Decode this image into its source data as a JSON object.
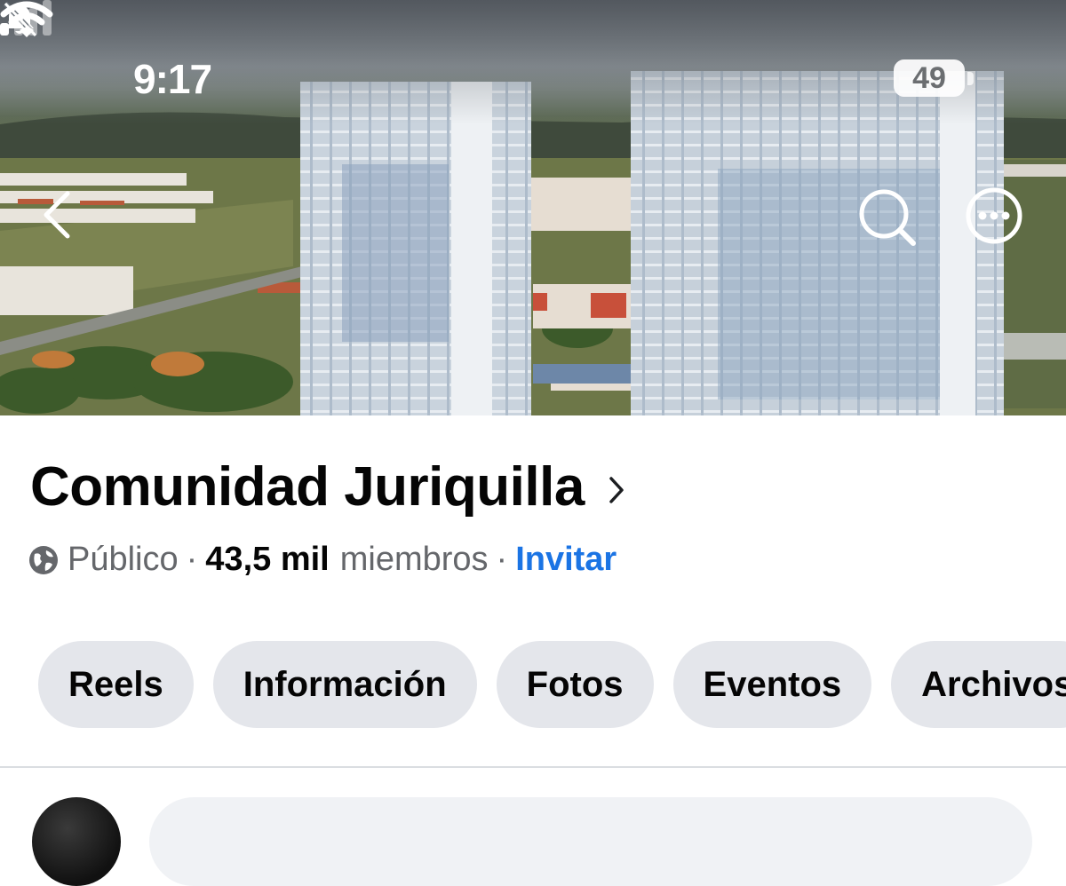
{
  "status_bar": {
    "time": "9:17",
    "battery": "49",
    "icons": [
      "bell-slash-icon",
      "cellular-signal-icon",
      "wifi-icon",
      "battery-icon"
    ]
  },
  "cover_nav": {
    "icons": [
      "chevron-left-icon",
      "search-icon",
      "more-icon"
    ]
  },
  "group": {
    "name": "Comunidad Juriquilla",
    "privacy_icon": "globe-icon",
    "privacy": "Público",
    "separator": "·",
    "members_count": "43,5 mil",
    "members_label": "miembros",
    "invite": "Invitar"
  },
  "tabs": [
    {
      "label": "Reels"
    },
    {
      "label": "Información"
    },
    {
      "label": "Fotos"
    },
    {
      "label": "Eventos"
    },
    {
      "label": "Archivos"
    }
  ],
  "colors": {
    "link": "#1b74e4",
    "tab_bg": "#e4e6eb",
    "text": "#050505",
    "secondary_text": "#65676b"
  }
}
